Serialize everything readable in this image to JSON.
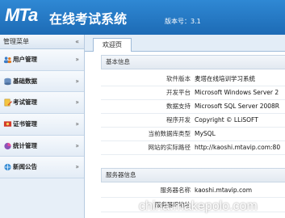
{
  "header": {
    "brand_mta": "MTa",
    "brand_name": "在线考试系统",
    "version": "版本号：3.1"
  },
  "sidebar": {
    "title": "管理菜单",
    "items": [
      {
        "label": "用户管理",
        "icon": "users-icon"
      },
      {
        "label": "基础数据",
        "icon": "database-icon"
      },
      {
        "label": "考试管理",
        "icon": "exam-icon"
      },
      {
        "label": "证书管理",
        "icon": "certificate-icon"
      },
      {
        "label": "统计管理",
        "icon": "chart-icon"
      },
      {
        "label": "新闻公告",
        "icon": "news-icon"
      }
    ]
  },
  "tabs": [
    {
      "label": "欢迎页"
    }
  ],
  "sections": [
    {
      "title": "基本信息",
      "rows": [
        {
          "label": "软件版本",
          "value": "麦塔在线培训学习系统"
        },
        {
          "label": "开发平台",
          "value": "Microsoft Windows Server 2"
        },
        {
          "label": "数据支持",
          "value": "Microsoft SQL Server 2008R"
        },
        {
          "label": "程序开发",
          "value": "Copyright © LLiSOFT"
        },
        {
          "label": "当前数据库类型",
          "value": "MySQL"
        },
        {
          "label": "网站的实际路径",
          "value": "http://kaoshi.mtavip.com:80"
        }
      ]
    },
    {
      "title": "服务器信息",
      "rows": [
        {
          "label": "服务器名称",
          "value": "kaoshi.mtavip.com"
        },
        {
          "label": "服务器IP地址",
          "value": ""
        }
      ]
    }
  ],
  "watermark": "china.makepolo.com",
  "colors": {
    "header": "#1d6bb5",
    "sidebar_bg": "#e7eff8",
    "accent": "#2f88d4"
  }
}
